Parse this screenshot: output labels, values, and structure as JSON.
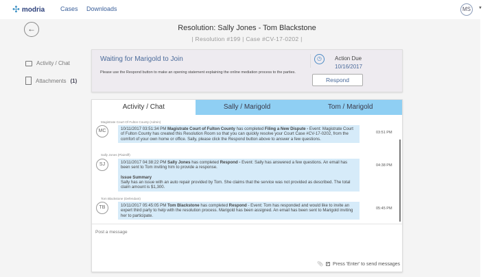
{
  "header": {
    "logo": "modria",
    "nav": [
      "Cases",
      "Downloads"
    ],
    "user_initials": "MS"
  },
  "page": {
    "title": "Resolution: Sally Jones - Tom Blackstone",
    "resolution": "Resolution #199",
    "case": "Case #CV-17-0202"
  },
  "sidebar": {
    "items": [
      {
        "label": "Activity / Chat"
      },
      {
        "label": "Attachments",
        "count": "(1)"
      }
    ]
  },
  "status": {
    "heading": "Waiting for Marigold to Join",
    "text": "Please use the Respond button to make an opening statement explaining the online mediation process to the parties.",
    "action_label": "Action Due",
    "action_date": "10/16/2017",
    "button": "Respond"
  },
  "tabs": [
    "Activity / Chat",
    "Sally / Marigold",
    "Tom / Marigold"
  ],
  "messages": [
    {
      "author": "Magistrate Court Of Fulton County (Admin)",
      "initials": "MC",
      "stamp": "10/11/2017 03:51:34 PM",
      "actor": "Magistrate Court of Fulton County",
      "verb": "has completed",
      "action": "Filing a New Dispute -",
      "body": "Event: Magistrate Court of Fulton County has created this Resolution Room so that you can quickly resolve your Court Case #CV-17-0202, from the comfort of your own home or office. Sally, please click the Respond button above to answer a few questions.",
      "time": "03:51 PM"
    },
    {
      "author": "Sally Jones (Plaintiff)",
      "initials": "SJ",
      "stamp": "10/11/2017 04:38:22 PM",
      "actor": "Sally Jones",
      "verb": "has completed",
      "action": "Respond -",
      "body": "Event: Sally has answered a few questions. An email has been sent to Tom inviting him to provide a response.",
      "summary_title": "Issue Summary",
      "summary": "Sally has an issue with an auto repair provided by Tom. She claims that the service was not provided as described. The total claim amount is $1,300.",
      "time": "04:38 PM"
    },
    {
      "author": "Tom Blackstone (Defendant)",
      "initials": "TB",
      "stamp": "10/11/2017 05:45:05 PM",
      "actor": "Tom Blackstone",
      "verb": "has completed",
      "action": "Respond",
      "body": "- Event: Tom has responded and would like to invite an expert third party to help with the resolution process. Marigold has been assigned. An email has been sent to Marigold inviting her to participate.",
      "time": "05:45 PM"
    }
  ],
  "composer": {
    "placeholder": "Post a message",
    "enter_label": "Press 'Enter' to send messages",
    "enter_checked": true
  }
}
